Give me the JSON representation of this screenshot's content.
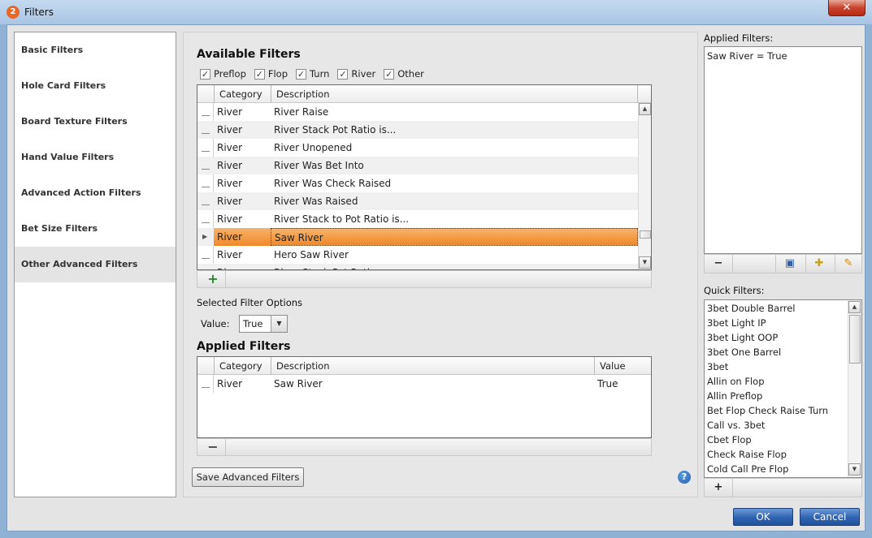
{
  "window": {
    "title": "Filters",
    "app_icon": "2",
    "close_glyph": "✕"
  },
  "sidebar": {
    "items": [
      {
        "label": "Basic Filters"
      },
      {
        "label": "Hole Card Filters"
      },
      {
        "label": "Board Texture Filters"
      },
      {
        "label": "Hand Value Filters"
      },
      {
        "label": "Advanced Action Filters"
      },
      {
        "label": "Bet Size Filters"
      },
      {
        "label": "Other Advanced Filters"
      }
    ],
    "active_index": 6
  },
  "available_filters": {
    "title": "Available Filters",
    "streets": [
      {
        "label": "Preflop",
        "checked": true
      },
      {
        "label": "Flop",
        "checked": true
      },
      {
        "label": "Turn",
        "checked": true
      },
      {
        "label": "River",
        "checked": true
      },
      {
        "label": "Other",
        "checked": true
      }
    ],
    "columns": {
      "category": "Category",
      "description": "Description"
    },
    "rows": [
      {
        "category": "River",
        "description": "River Raise"
      },
      {
        "category": "River",
        "description": "River Stack Pot Ratio is..."
      },
      {
        "category": "River",
        "description": "River Unopened"
      },
      {
        "category": "River",
        "description": "River Was Bet Into"
      },
      {
        "category": "River",
        "description": "River Was Check Raised"
      },
      {
        "category": "River",
        "description": "River Was Raised"
      },
      {
        "category": "River",
        "description": "River Stack to Pot Ratio is..."
      },
      {
        "category": "River",
        "description": "Saw River",
        "selected": true
      },
      {
        "category": "River",
        "description": "Hero Saw River"
      },
      {
        "category": "River",
        "description": "River Stack Pot Ratio"
      }
    ],
    "add_glyph": "+"
  },
  "selected_options": {
    "title": "Selected Filter Options",
    "value_label": "Value:",
    "value": "True",
    "dropdown_glyph": "▼"
  },
  "applied_filters": {
    "title": "Applied Filters",
    "columns": {
      "category": "Category",
      "description": "Description",
      "value": "Value"
    },
    "rows": [
      {
        "category": "River",
        "description": "Saw River",
        "value": "True"
      }
    ],
    "remove_glyph": "−"
  },
  "save_button": "Save Advanced Filters",
  "help_glyph": "?",
  "right_panel": {
    "applied_label": "Applied Filters:",
    "applied_text": "Saw River = True",
    "toolbar_remove": "−",
    "quick_label": "Quick Filters:",
    "quick_filters": [
      "3bet Double Barrel",
      "3bet Light IP",
      "3bet Light OOP",
      "3bet One Barrel",
      "3bet",
      "Allin on Flop",
      "Allin Preflop",
      "Bet Flop Check Raise Turn",
      "Call vs. 3bet",
      "Cbet Flop",
      "Check Raise Flop",
      "Cold Call Pre Flop"
    ],
    "quick_add": "+"
  },
  "footer": {
    "ok": "OK",
    "cancel": "Cancel"
  }
}
